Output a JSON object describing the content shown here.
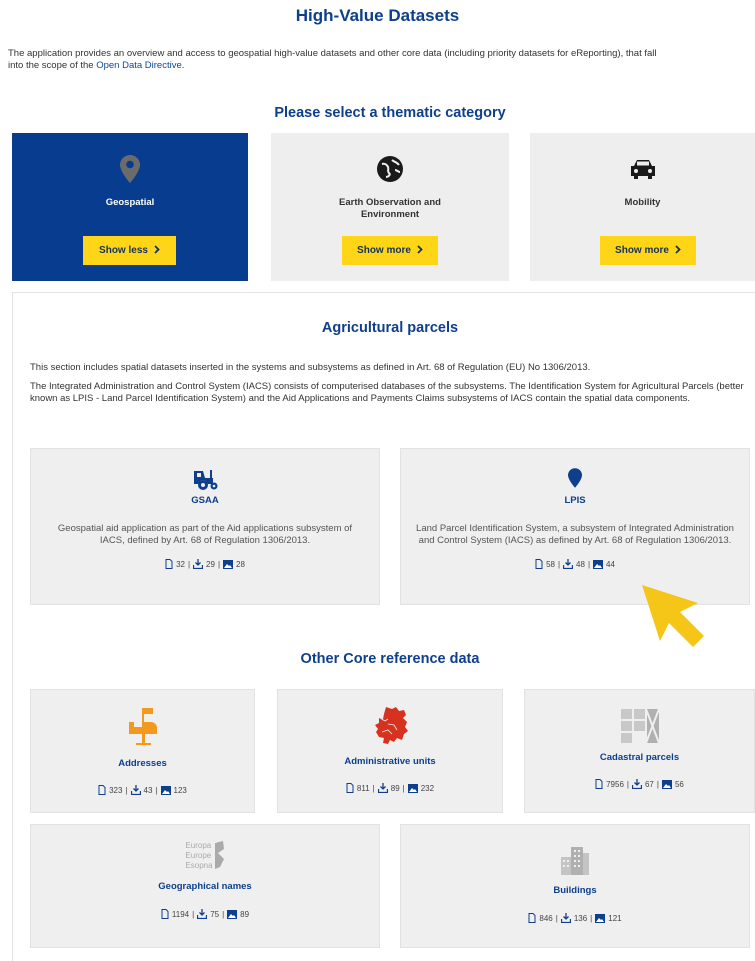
{
  "page": {
    "title": "High-Value Datasets",
    "intro_text": "The application provides an overview and access to geospatial high-value datasets and other core data (including priority datasets for eReporting), that fall",
    "intro_text_2": "into the scope of the ",
    "intro_link": "Open Data Directive",
    "intro_end": "."
  },
  "categories": {
    "heading": "Please select a thematic category",
    "items": [
      {
        "label": "Geospatial",
        "button": "Show less",
        "icon": "map-pin-icon",
        "active": true
      },
      {
        "label": "Earth Observation and Environment",
        "button": "Show more",
        "icon": "globe-icon",
        "active": false
      },
      {
        "label": "Mobility",
        "button": "Show more",
        "icon": "car-icon",
        "active": false
      }
    ]
  },
  "agri": {
    "heading": "Agricultural parcels",
    "para1": "This section includes spatial datasets inserted in the systems and subsystems as defined in Art. 68 of Regulation (EU) No 1306/2013.",
    "para2": "The Integrated Administration and Control System (IACS) consists of computerised databases of the subsystems. The Identification System for Agricultural Parcels (better known as LPIS - Land Parcel Identification System) and the Aid Applications and Payments Claims subsystems of IACS contain the spatial data components.",
    "cards": [
      {
        "name": "GSAA",
        "icon": "tractor-icon",
        "desc": "Geospatial aid application as part of the Aid applications subsystem of IACS, defined by Art. 68 of Regulation 1306/2013.",
        "docs": "32",
        "downloads": "29",
        "maps": "28"
      },
      {
        "name": "LPIS",
        "icon": "map-pin-icon",
        "desc": "Land Parcel Identification System, a subsystem of Integrated Administration and Control System (IACS) as defined by Art. 68 of Regulation 1306/2013.",
        "docs": "58",
        "downloads": "48",
        "maps": "44"
      }
    ]
  },
  "core": {
    "heading": "Other Core reference data",
    "cards": [
      {
        "name": "Addresses",
        "icon": "mailbox-icon",
        "docs": "323",
        "downloads": "43",
        "maps": "123"
      },
      {
        "name": "Administrative units",
        "icon": "europe-map-icon",
        "docs": "811",
        "downloads": "89",
        "maps": "232"
      },
      {
        "name": "Cadastral parcels",
        "icon": "parcels-icon",
        "docs": "7956",
        "downloads": "67",
        "maps": "56"
      },
      {
        "name": "Geographical names",
        "icon": "geonames-icon",
        "docs": "1194",
        "downloads": "75",
        "maps": "89",
        "logo_lines": [
          "Europa",
          "Europe",
          "Esopna"
        ]
      },
      {
        "name": "Buildings",
        "icon": "buildings-icon",
        "docs": "846",
        "downloads": "136",
        "maps": "121"
      }
    ]
  },
  "colors": {
    "brand_blue": "#0e3f8c",
    "active_card": "#083c8e",
    "button_yellow": "#ffd617",
    "cursor_yellow": "#f5c518",
    "icon_orange": "#f29a1f",
    "icon_red": "#d7321f"
  }
}
